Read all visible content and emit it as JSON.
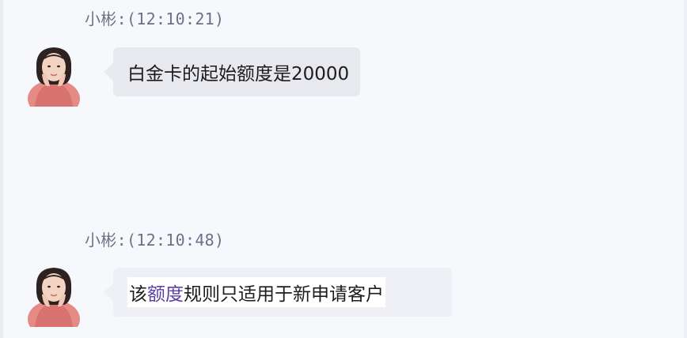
{
  "colors": {
    "background": "#f7f8fc",
    "bubble": "#e8e9ee",
    "link": "#5b3fa3",
    "sender_text": "#6c7285"
  },
  "messages": [
    {
      "sender": "小彬",
      "header": "小彬:(12:10:21)",
      "avatar_icon": "user-avatar-icon",
      "text": "白金卡的起始额度是20000"
    },
    {
      "sender": "小彬",
      "header": "小彬:(12:10:48)",
      "avatar_icon": "user-avatar-icon",
      "text_before": "该",
      "link_text": "额度",
      "text_after": "规则只适用于新申请客户"
    }
  ]
}
